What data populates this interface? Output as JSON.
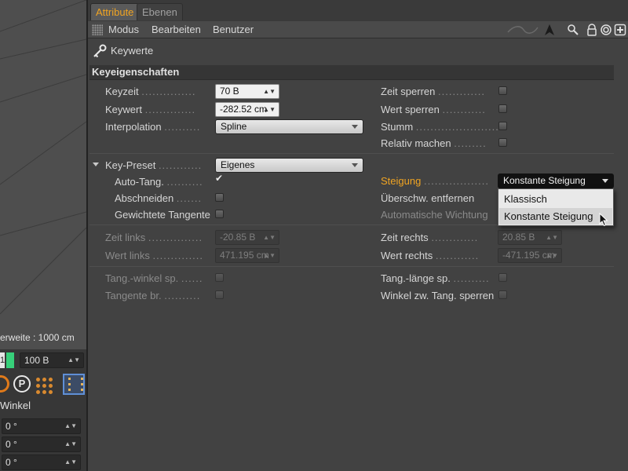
{
  "tabs": [
    "Attribute",
    "Ebenen"
  ],
  "menu": [
    "Modus",
    "Bearbeiten",
    "Benutzer"
  ],
  "toolbar_icons": [
    "curve-icon",
    "arrow-icon",
    "search-icon",
    "lock-icon",
    "target-icon",
    "new-icon"
  ],
  "title": "Keywerte",
  "section": "Keyeigenschaften",
  "rows": {
    "keyzeit": {
      "label": "Keyzeit",
      "value": "70 B"
    },
    "keywert": {
      "label": "Keywert",
      "value": "-282.52 cm"
    },
    "interpolation": {
      "label": "Interpolation",
      "value": "Spline"
    },
    "zeit_sperren": {
      "label": "Zeit sperren",
      "checked": false
    },
    "wert_sperren": {
      "label": "Wert sperren",
      "checked": false
    },
    "stumm": {
      "label": "Stumm",
      "checked": false
    },
    "relativ": {
      "label": "Relativ machen",
      "checked": false
    },
    "key_preset": {
      "label": "Key-Preset",
      "value": "Eigenes"
    },
    "auto_tang": {
      "label": "Auto-Tang.",
      "checked": true
    },
    "abschneiden": {
      "label": "Abschneiden",
      "checked": false
    },
    "gewichtete": {
      "label": "Gewichtete Tangente",
      "checked": false
    },
    "steigung": {
      "label": "Steigung",
      "value": "Konstante Steigung"
    },
    "ueberschw": {
      "label": "Überschw. entfernen"
    },
    "auto_wichtung": {
      "label": "Automatische Wichtung"
    },
    "zeit_links": {
      "label": "Zeit links",
      "value": "-20.85 B"
    },
    "wert_links": {
      "label": "Wert links",
      "value": "471.195 cm"
    },
    "zeit_rechts": {
      "label": "Zeit rechts",
      "value": "20.85 B"
    },
    "wert_rechts": {
      "label": "Wert rechts",
      "value": "-471.195 cm"
    },
    "tang_winkel": {
      "label": "Tang.-winkel sp.",
      "checked": false
    },
    "tangente_br": {
      "label": "Tangente br.",
      "checked": false
    },
    "tang_laenge": {
      "label": "Tang.-länge sp.",
      "checked": false
    },
    "winkel_zw": {
      "label": "Winkel zw. Tang. sperren",
      "checked": false
    }
  },
  "steigung_menu": [
    "Klassisch",
    "Konstante Steigung"
  ],
  "left": {
    "grid_label": "erweite : 1000 cm",
    "frame_value": "100 B",
    "green_digit": "1",
    "winkel_label": "Winkel",
    "winkel_values": [
      "0 °",
      "0 °",
      "0 °"
    ]
  },
  "colors": {
    "accent": "#f0a422",
    "background": "#424242"
  }
}
